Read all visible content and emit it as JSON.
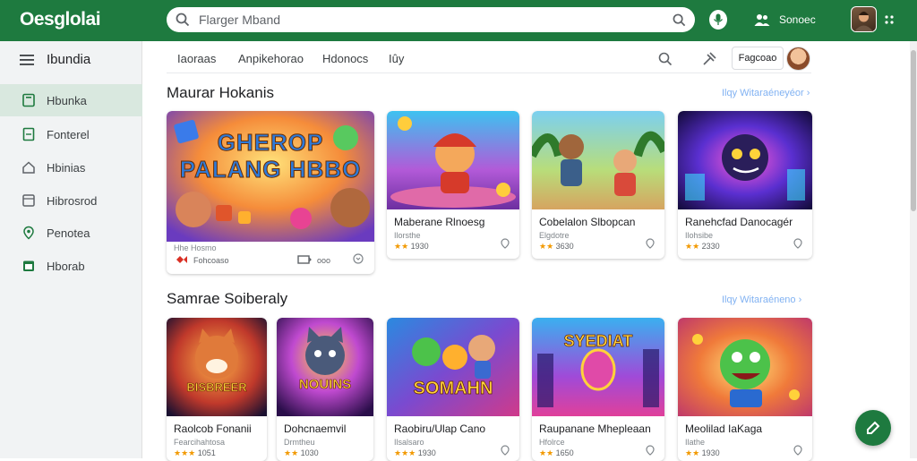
{
  "app": {
    "logo": "Oesglolai"
  },
  "header": {
    "search_placeholder": "Flarger Mband",
    "account_label": "Sonoec"
  },
  "sidebar": {
    "title": "Ibundia",
    "items": [
      {
        "label": "Hbunka",
        "icon": "tablet-icon",
        "active": true
      },
      {
        "label": "Fonterel",
        "icon": "doc-icon"
      },
      {
        "label": "Hbinias",
        "icon": "home-icon"
      },
      {
        "label": "Hibrosrod",
        "icon": "grid-icon"
      },
      {
        "label": "Penotea",
        "icon": "pin-icon"
      },
      {
        "label": "Hborab",
        "icon": "calendar-icon"
      }
    ]
  },
  "tabs": [
    "Iaoraas",
    "Anpikehorao",
    "Hdonocs",
    "Iûy"
  ],
  "topbar": {
    "signin_label": "Fagcoao"
  },
  "sections": [
    {
      "title": "Maurar Hokanis",
      "link": "Ilqy Witaraéneyéor",
      "cards": [
        {
          "name": "",
          "sub": "Hhe Hosmo",
          "rating_text": "Fohcoaso",
          "stars": "",
          "featured_text": "GHEROP PALANG HBBO"
        },
        {
          "name": "Maberane Rlnoesg",
          "sub": "Ilorsthe",
          "stars": "★★",
          "rating_text": "1930"
        },
        {
          "name": "Cobelalon Slbopcan",
          "sub": "Elgdotre",
          "stars": "★★",
          "rating_text": "3630"
        },
        {
          "name": "Ranehcfad Danocagér",
          "sub": "Ilohsibe",
          "stars": "★★",
          "rating_text": "2330"
        }
      ]
    },
    {
      "title": "Samrae Soiberaly",
      "link": "Ilqy Witaraéneno",
      "cards": [
        {
          "name": "Raolcob Fonanii",
          "sub": "Fearcihahtosa",
          "stars": "★★★",
          "rating_text": "1051",
          "art_text": "BISBREER"
        },
        {
          "name": "Dohcnaemvil",
          "sub": "Drmtheu",
          "stars": "★★",
          "rating_text": "1030",
          "art_text": "NOUINS"
        },
        {
          "name": "Raobiru/Ulap Cano",
          "sub": "Ilsalsaro",
          "stars": "★★★",
          "rating_text": "1930",
          "art_text": "SOMAHN"
        },
        {
          "name": "Raupanane Mhepleaan",
          "sub": "Hfolrce",
          "stars": "★★",
          "rating_text": "1650",
          "art_text": "SYEDIAT"
        },
        {
          "name": "Meolilad IaKaga",
          "sub": "Ilathe",
          "stars": "★★",
          "rating_text": "1930",
          "art_text": ""
        }
      ]
    }
  ],
  "colors": {
    "brand": "#1e7a3f",
    "active_bg": "#d9e8df",
    "star": "#f29900"
  }
}
